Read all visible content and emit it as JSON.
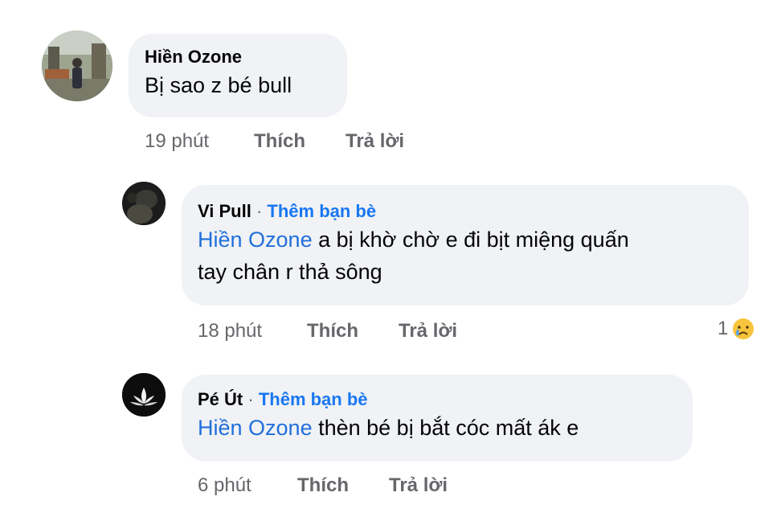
{
  "comments": [
    {
      "author": "Hiền Ozone",
      "text": "Bị sao z bé bull",
      "time": "19 phút",
      "like_label": "Thích",
      "reply_label": "Trả lời"
    },
    {
      "author": "Vi Pull",
      "separator": "·",
      "add_friend_label": "Thêm bạn bè",
      "mention": "Hiền Ozone",
      "text_line1": " a bị khờ chờ e đi bịt miệng quấn",
      "text_line2": "tay chân r thả sông",
      "time": "18 phút",
      "like_label": "Thích",
      "reply_label": "Trả lời",
      "reaction_count": "1",
      "reaction_icon": "crying-face-icon"
    },
    {
      "author": "Pé Út",
      "separator": "·",
      "add_friend_label": "Thêm bạn bè",
      "mention": "Hiền Ozone",
      "text": " thèn bé bị bắt cóc mất ák e",
      "time": "6 phút",
      "like_label": "Thích",
      "reply_label": "Trả lời"
    }
  ]
}
